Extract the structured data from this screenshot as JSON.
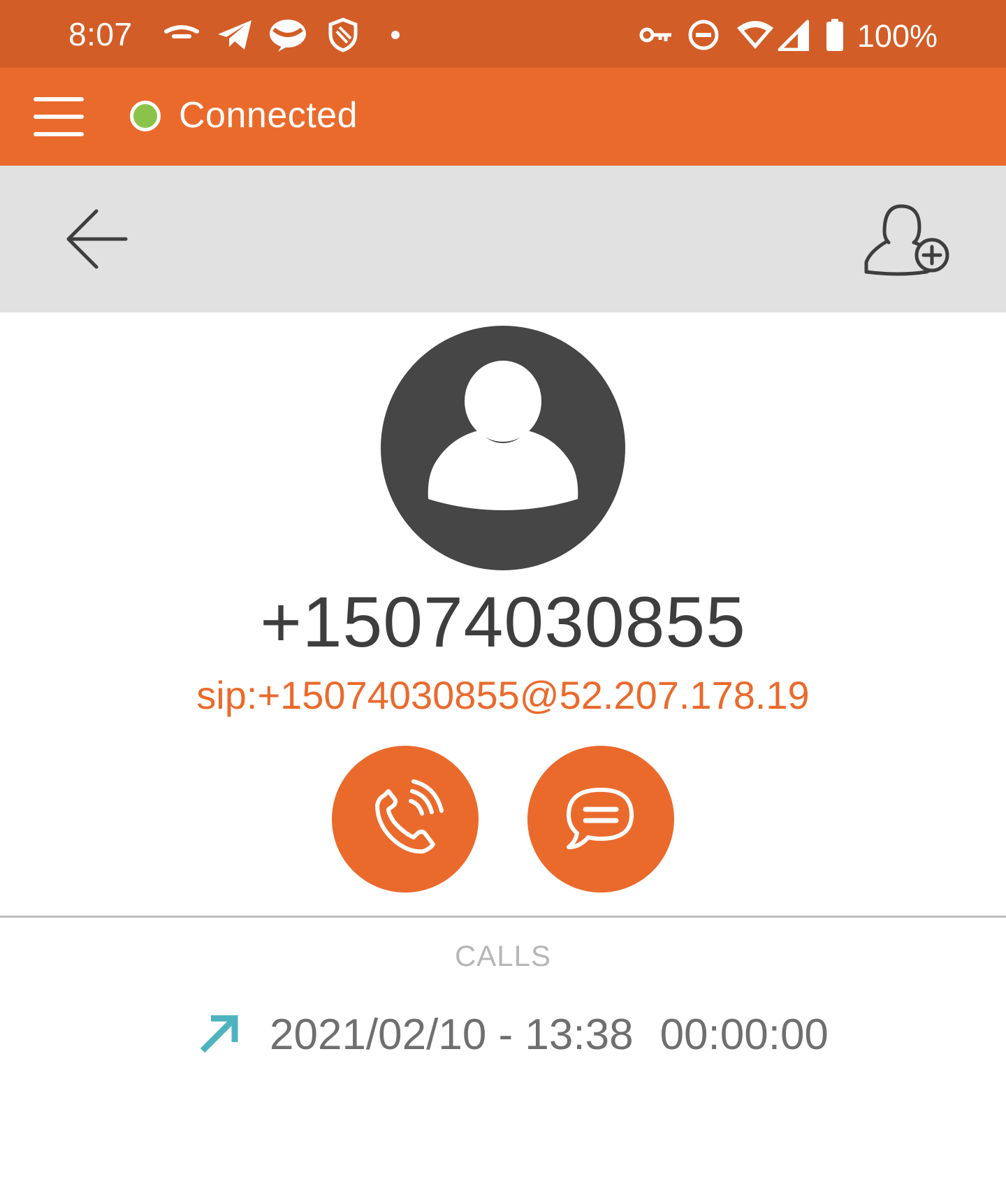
{
  "status_bar": {
    "time": "8:07",
    "battery": "100%",
    "left_icons": [
      "voicemail-icon",
      "telegram-icon",
      "messaging-app-icon",
      "shield-icon",
      "notification-dot-icon"
    ],
    "right_icons": [
      "vpn-key-icon",
      "do-not-disturb-icon",
      "wifi-icon",
      "cellular-signal-icon",
      "battery-icon"
    ]
  },
  "app_bar": {
    "connection_status": "Connected",
    "status_color": "#8BC34A",
    "accent_color": "#EA6A2C"
  },
  "contact": {
    "number": "+15074030855",
    "sip_address": "sip:+15074030855@52.207.178.19"
  },
  "actions": [
    "call-button",
    "message-button"
  ],
  "calls": {
    "header": "CALLS",
    "entries": [
      {
        "direction": "outgoing",
        "datetime": "2021/02/10 - 13:38",
        "duration": "00:00:00",
        "icon_color": "#4FB3BF"
      }
    ]
  }
}
